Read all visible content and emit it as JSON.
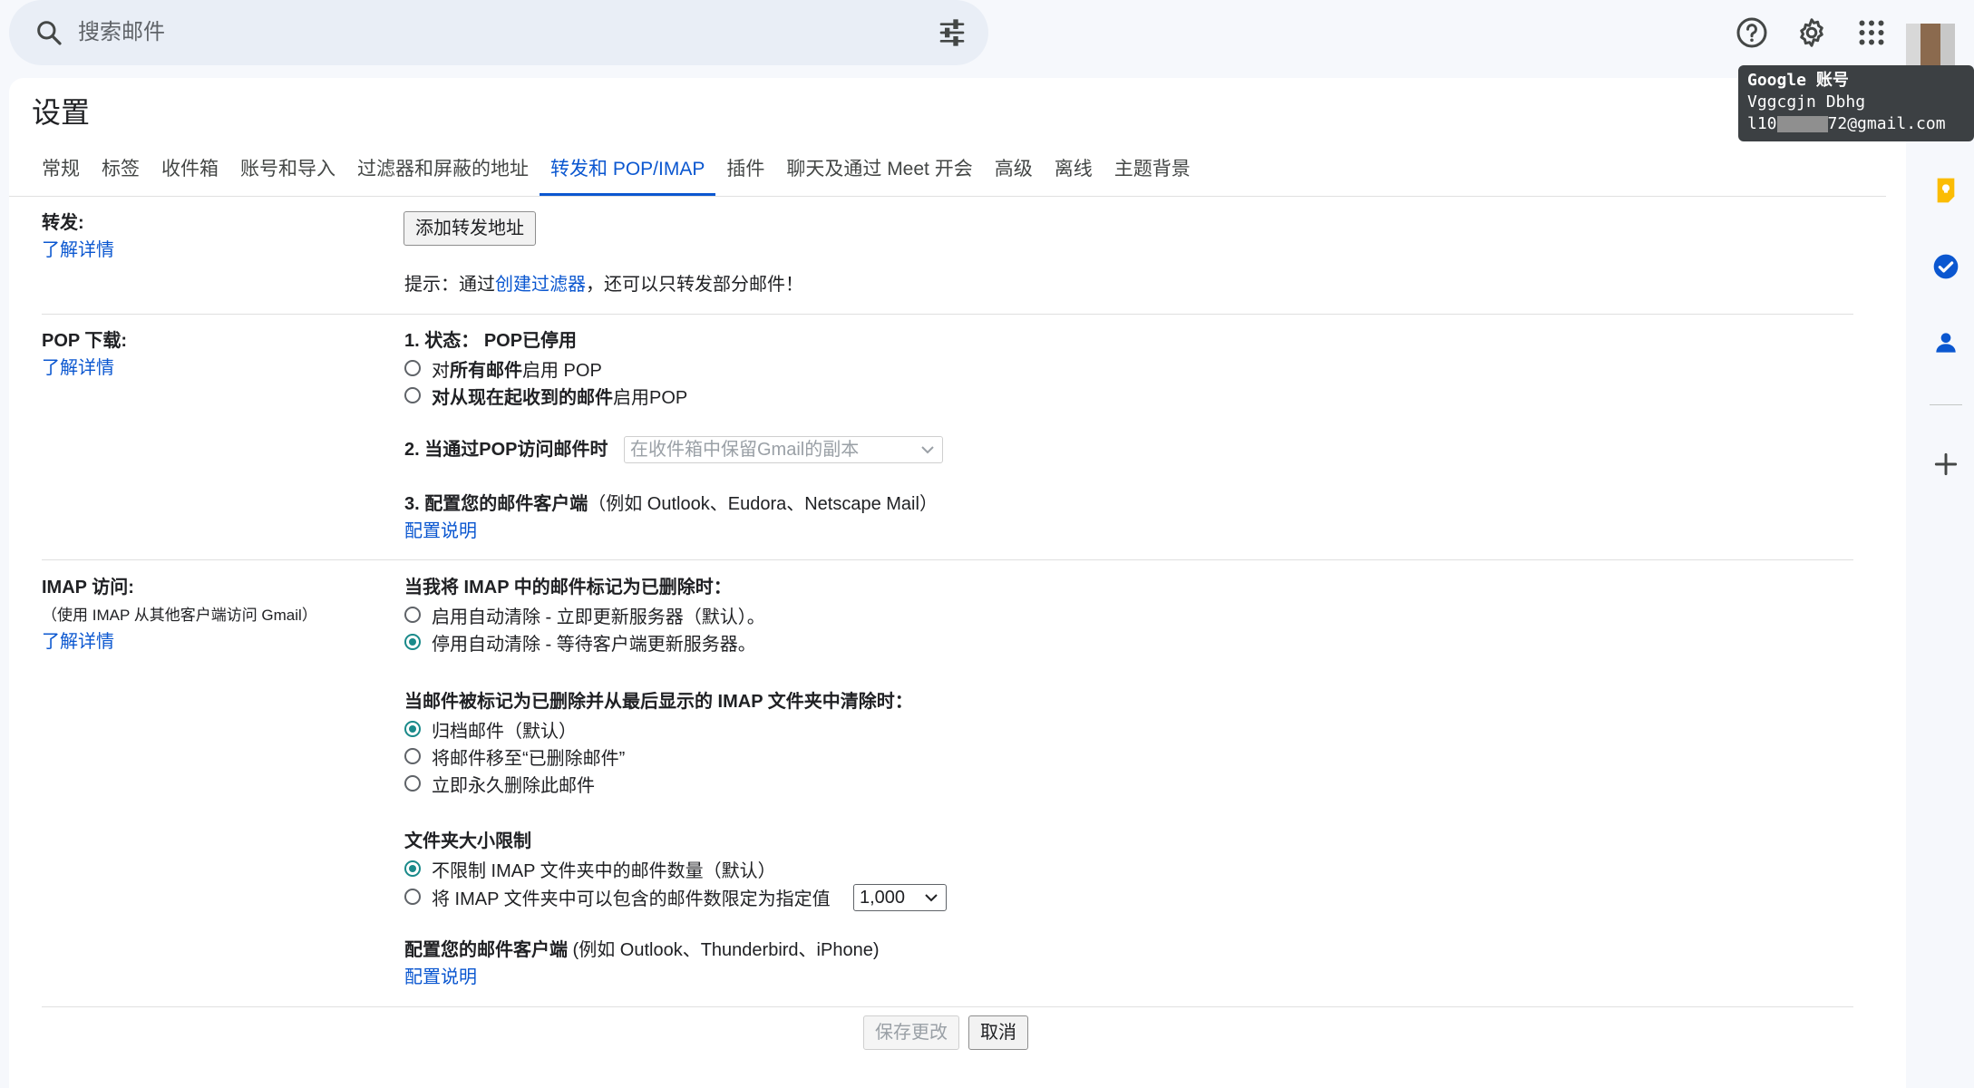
{
  "search": {
    "placeholder": "搜索邮件"
  },
  "account_tooltip": {
    "title": "Google 账号",
    "name": "Vggcgjn Dbhg",
    "email_prefix": "l10",
    "email_suffix": "72@gmail.com"
  },
  "page": {
    "title": "设置"
  },
  "tabs": [
    {
      "label": "常规"
    },
    {
      "label": "标签"
    },
    {
      "label": "收件箱"
    },
    {
      "label": "账号和导入"
    },
    {
      "label": "过滤器和屏蔽的地址"
    },
    {
      "label": "转发和 POP/IMAP",
      "active": true
    },
    {
      "label": "插件"
    },
    {
      "label": "聊天及通过 Meet 开会"
    },
    {
      "label": "高级"
    },
    {
      "label": "离线"
    },
    {
      "label": "主题背景"
    }
  ],
  "forwarding": {
    "label": "转发:",
    "learn_more": "了解详情",
    "add_button": "添加转发地址",
    "tip_prefix": "提示：通过",
    "tip_link": "创建过滤器",
    "tip_suffix": "，还可以只转发部分邮件！"
  },
  "pop": {
    "label": "POP 下载:",
    "learn_more": "了解详情",
    "status_label": "1. 状态：",
    "status_value": "POP已停用",
    "option_all_prefix": "对",
    "option_all_bold": "所有邮件",
    "option_all_suffix": "启用 POP",
    "option_now_bold": "对从现在起收到的邮件",
    "option_now_suffix": "启用POP",
    "access_label": "2. 当通过POP访问邮件时",
    "access_select": "在收件箱中保留Gmail的副本",
    "configure_label": "3. 配置您的邮件客户端",
    "configure_example": "（例如 Outlook、Eudora、Netscape Mail）",
    "configure_link": "配置说明"
  },
  "imap": {
    "label": "IMAP 访问:",
    "sublabel": "（使用 IMAP 从其他客户端访问 Gmail）",
    "learn_more": "了解详情",
    "delete_heading": "当我将 IMAP 中的邮件标记为已删除时：",
    "delete_options": [
      {
        "label": "启用自动清除 - 立即更新服务器（默认）。",
        "checked": false
      },
      {
        "label": "停用自动清除 - 等待客户端更新服务器。",
        "checked": true
      }
    ],
    "expunge_heading": "当邮件被标记为已删除并从最后显示的 IMAP 文件夹中清除时：",
    "expunge_options": [
      {
        "label": "归档邮件（默认）",
        "checked": true
      },
      {
        "label": "将邮件移至“已删除邮件”",
        "checked": false
      },
      {
        "label": "立即永久删除此邮件",
        "checked": false
      }
    ],
    "folder_heading": "文件夹大小限制",
    "folder_options": [
      {
        "label": "不限制 IMAP 文件夹中的邮件数量（默认）",
        "checked": true
      },
      {
        "label": "将 IMAP 文件夹中可以包含的邮件数限定为指定值",
        "checked": false
      }
    ],
    "folder_limit_select": "1,000",
    "configure_label": "配置您的邮件客户端",
    "configure_example": " (例如 Outlook、Thunderbird、iPhone)",
    "configure_link": "配置说明"
  },
  "footer": {
    "save_button": "保存更改",
    "cancel_button": "取消"
  },
  "colors": {
    "accent": "#0b57d0",
    "radio_checked": "#1a8a8a",
    "background": "#f6f8fc"
  },
  "icons": [
    "search-icon",
    "tune-icon",
    "help-icon",
    "settings-icon",
    "apps-icon",
    "keep-icon",
    "tasks-icon",
    "contacts-icon",
    "add-icon"
  ]
}
